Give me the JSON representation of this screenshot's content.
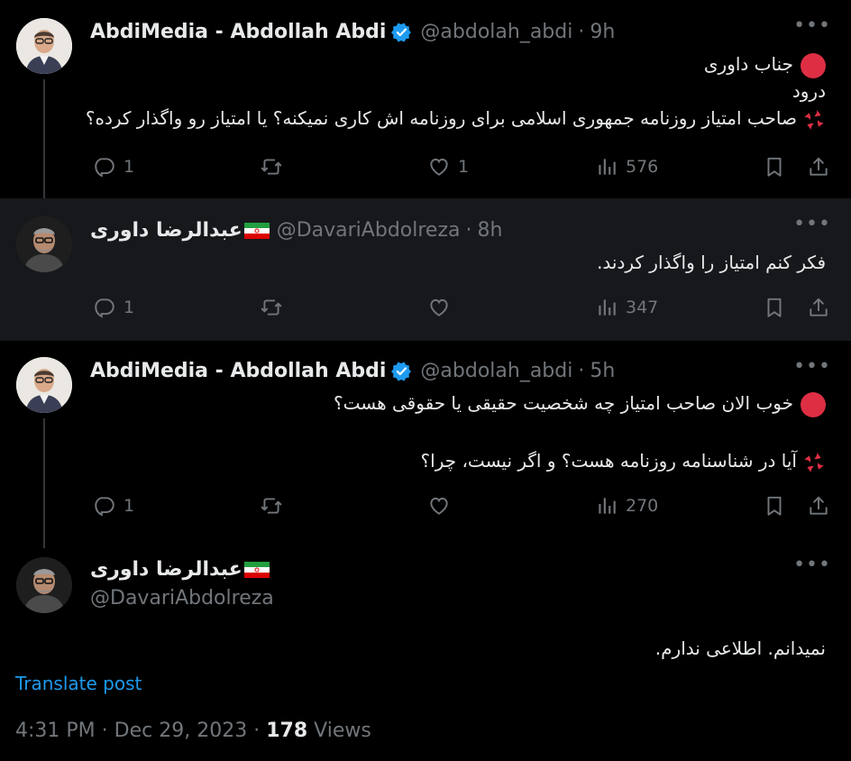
{
  "tweets": [
    {
      "name": "AbdiMedia - Abdollah Abdi",
      "handle": "@abdolah_abdi",
      "time": "9h",
      "lines": [
        "جناب داوری",
        "درود",
        "صاحب امتیاز روزنامه جمهوری اسلامی برای روزنامه اش کاری نمیکنه؟ یا امتیاز رو واگذار کرده؟"
      ],
      "replies": "1",
      "retweets": "",
      "likes": "1",
      "views": "576"
    },
    {
      "name": "عبدالرضا داوری",
      "handle": "@DavariAbdolreza",
      "time": "8h",
      "lines": [
        "فکر کنم امتیاز را واگذار کردند."
      ],
      "replies": "1",
      "retweets": "",
      "likes": "",
      "views": "347"
    },
    {
      "name": "AbdiMedia - Abdollah Abdi",
      "handle": "@abdolah_abdi",
      "time": "5h",
      "lines": [
        "خوب الان صاحب امتیاز چه شخصیت حقیقی یا حقوقی هست؟",
        "آیا در شناسنامه روزنامه هست؟ و اگر نیست، چرا؟"
      ],
      "replies": "1",
      "retweets": "",
      "likes": "",
      "views": "270"
    }
  ],
  "main": {
    "name": "عبدالرضا داوری",
    "handle": "@DavariAbdolreza",
    "text": "نمیدانم. اطلاعی ندارم.",
    "translate": "Translate post",
    "time": "4:31 PM",
    "date": "Dec 29, 2023",
    "views_count": "178",
    "views_label": "Views"
  },
  "icons": {
    "reply": "reply-icon",
    "retweet": "retweet-icon",
    "like": "heart-icon",
    "views": "views-icon",
    "bookmark": "bookmark-icon",
    "share": "share-icon",
    "verified": "verified-badge-icon",
    "flag": "iran-flag-icon",
    "more": "more-icon"
  },
  "colors": {
    "accent": "#1d9bf0",
    "secondary": "#71767b",
    "text": "#e7e9ea",
    "background": "#000000",
    "highlight": "#16181c"
  }
}
